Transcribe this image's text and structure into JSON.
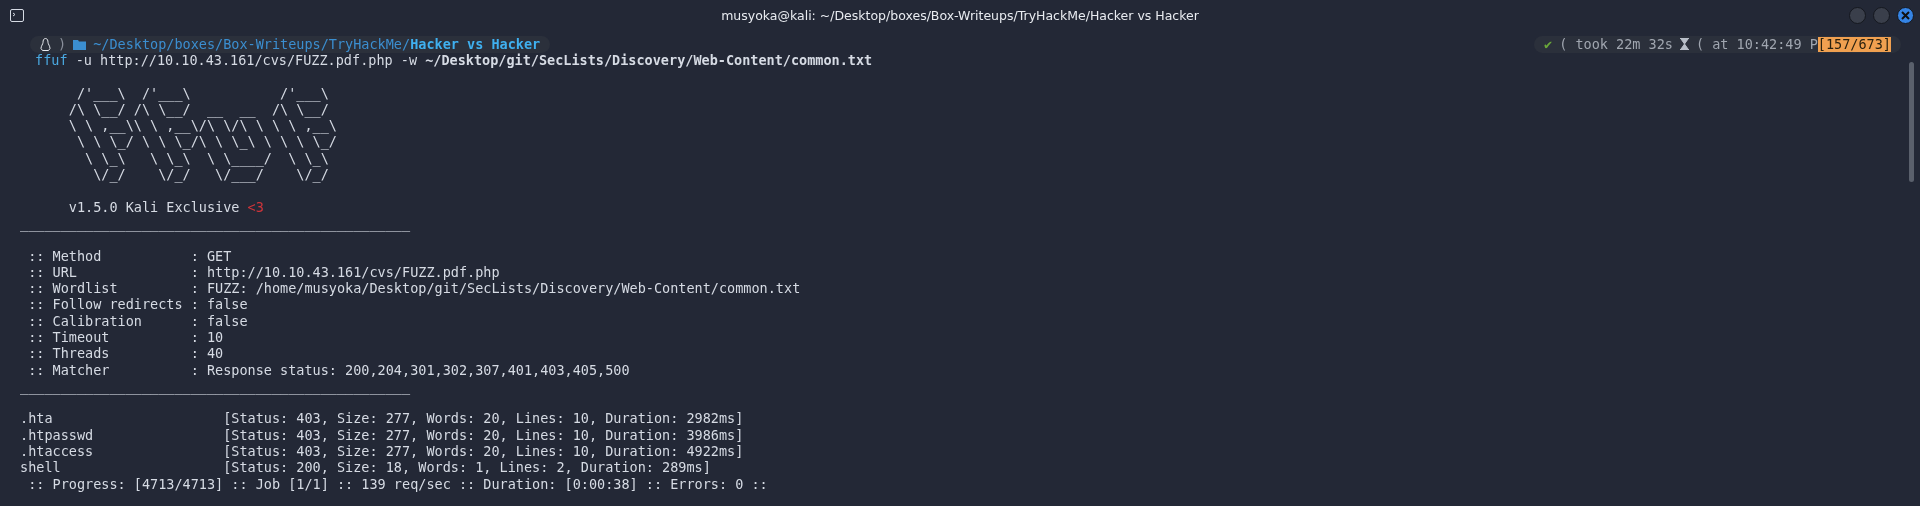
{
  "window": {
    "title": "musyoka@kali: ~/Desktop/boxes/Box-Writeups/TryHackMe/Hacker vs Hacker"
  },
  "prompt": {
    "separator": ")",
    "path": "~/Desktop/boxes/Box-Writeups/TryHackMe/",
    "current_dir": "Hacker vs Hacker"
  },
  "status": {
    "mark": "✔",
    "took": "( took 22m 32s",
    "time": "( at 10:42:49 P",
    "counter": "[157/673]"
  },
  "command": {
    "program": "ffuf",
    "args": "-u http://10.10.43.161/cvs/FUZZ.pdf.php -w",
    "wordlist": "~/Desktop/git/SecLists/Discovery/Web-Content/common.txt"
  },
  "banner": {
    "art": [
      "       /'___\\  /'___\\           /'___\\",
      "      /\\ \\__/ /\\ \\__/  __  __  /\\ \\__/",
      "      \\ \\ ,__\\\\ \\ ,__\\/\\ \\/\\ \\ \\ \\ ,__\\",
      "       \\ \\ \\_/ \\ \\ \\_/\\ \\ \\_\\ \\ \\ \\ \\_/",
      "        \\ \\_\\   \\ \\_\\  \\ \\____/  \\ \\_\\",
      "         \\/_/    \\/_/   \\/___/    \\/_/"
    ],
    "version": "      v1.5.0 Kali Exclusive",
    "heart": "<3"
  },
  "rules": [
    "________________________________________________",
    "________________________________________________"
  ],
  "config": [
    " :: Method           : GET",
    " :: URL              : http://10.10.43.161/cvs/FUZZ.pdf.php",
    " :: Wordlist         : FUZZ: /home/musyoka/Desktop/git/SecLists/Discovery/Web-Content/common.txt",
    " :: Follow redirects : false",
    " :: Calibration      : false",
    " :: Timeout          : 10",
    " :: Threads          : 40",
    " :: Matcher          : Response status: 200,204,301,302,307,401,403,405,500"
  ],
  "results": [
    {
      "path": ".hta",
      "info": "[Status: 403, Size: 277, Words: 20, Lines: 10, Duration: 2982ms]"
    },
    {
      "path": ".htpasswd",
      "info": "[Status: 403, Size: 277, Words: 20, Lines: 10, Duration: 3986ms]"
    },
    {
      "path": ".htaccess",
      "info": "[Status: 403, Size: 277, Words: 20, Lines: 10, Duration: 4922ms]"
    },
    {
      "path": "shell",
      "info": "[Status: 200, Size: 18, Words: 1, Lines: 2, Duration: 289ms]"
    }
  ],
  "progress": ":: Progress: [4713/4713] :: Job [1/1] :: 139 req/sec :: Duration: [0:00:38] :: Errors: 0 ::"
}
